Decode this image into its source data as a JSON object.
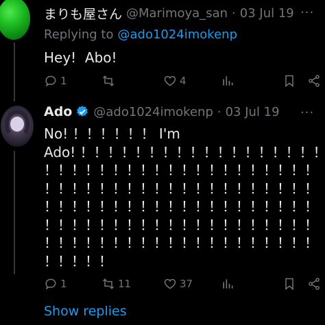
{
  "tweet1": {
    "display_name": "まりも屋さん",
    "handle": "@Marimoya_san",
    "separator": "·",
    "date": "03 Jul 19",
    "replying_prefix": "Replying to",
    "replying_to": "@ado1024imokenp",
    "text": "Hey!  Abo!",
    "replies": "1",
    "retweets": "",
    "likes": "4",
    "more": "···"
  },
  "tweet2": {
    "display_name": "Ado",
    "handle": "@ado1024imokenp",
    "separator": "·",
    "date": "03 Jul 19",
    "lines": [
      "No! ！！！！！！ I'm",
      "Ado! ！！！！！！！！！！！！！！！！！！",
      "！！！！！！！！！！！！！！！！！！！！",
      "！！！！！！！！！！！！！！！！！！！！",
      "！！！！！！！！！！！！！！！！！！！！",
      "！！！！！！！！！！！！！！！！！！！！",
      "！！！！！！！！！！！！！！！！！！！！",
      "！！！！！"
    ],
    "replies": "1",
    "retweets": "11",
    "likes": "37",
    "more": "···"
  },
  "show_replies": "Show replies",
  "colors": {
    "accent": "#1d9bf0",
    "muted": "#71767b",
    "verified": "#1d9bf0"
  }
}
